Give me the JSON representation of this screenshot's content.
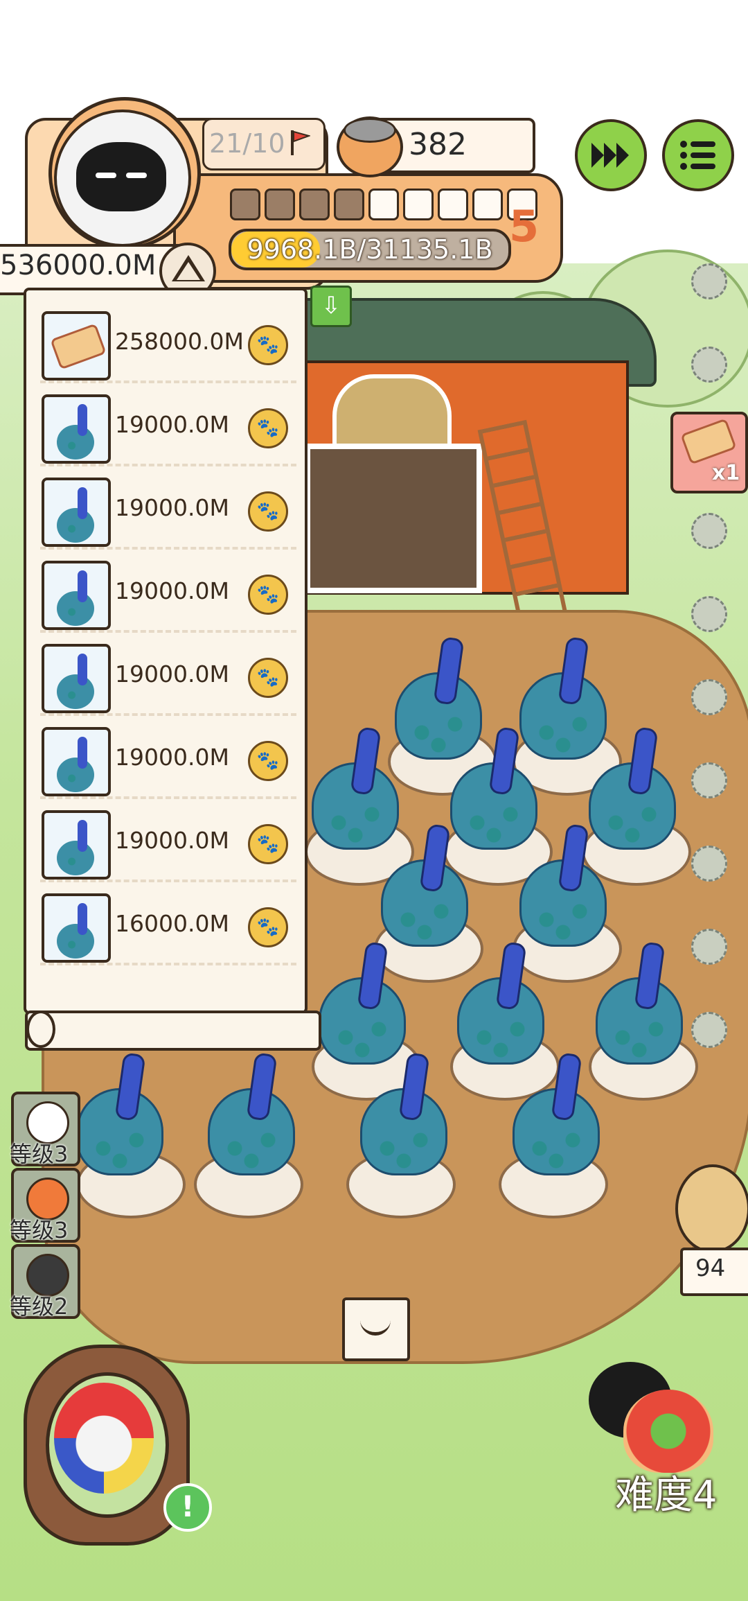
{
  "hud": {
    "stage_progress": "21/10",
    "coins": "382",
    "level": "5",
    "level_segments_filled": 4,
    "level_segments_total": 9,
    "xp_text": "9968.1B/31135.1B",
    "xp_fraction": 0.32
  },
  "list": {
    "total_value": "536000.0M",
    "items": [
      {
        "icon": "scroll-item-icon",
        "value": "258000.0M"
      },
      {
        "icon": "peacock-icon",
        "value": "19000.0M"
      },
      {
        "icon": "peacock-icon",
        "value": "19000.0M"
      },
      {
        "icon": "peacock-icon",
        "value": "19000.0M"
      },
      {
        "icon": "peacock-icon",
        "value": "19000.0M"
      },
      {
        "icon": "peacock-icon",
        "value": "19000.0M"
      },
      {
        "icon": "peacock-icon",
        "value": "19000.0M"
      },
      {
        "icon": "peacock-icon",
        "value": "16000.0M"
      }
    ]
  },
  "reward": {
    "count": "x1"
  },
  "skills": [
    {
      "label": "等级3"
    },
    {
      "label": "等级3"
    },
    {
      "label": "等级2"
    }
  ],
  "owl": {
    "count": "94"
  },
  "difficulty": {
    "label": "难度4"
  },
  "colors": {
    "accent_orange": "#f6b97c",
    "button_green": "#8fd14a",
    "panel_bg": "#fbf5ea"
  }
}
